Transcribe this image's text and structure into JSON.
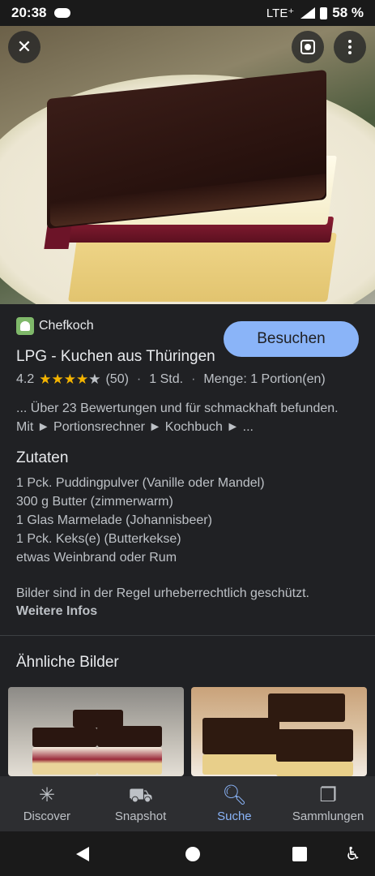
{
  "status_bar": {
    "time": "20:38",
    "network": "LTE⁺",
    "battery": "58 %"
  },
  "hero": {
    "close_icon": "close-icon",
    "lens_icon": "lens-icon",
    "more_icon": "more-vert-icon"
  },
  "result": {
    "source": "Chefkoch",
    "visit_label": "Besuchen",
    "title": "LPG - Kuchen aus Thüringen",
    "rating": "4.2",
    "stars_filled": 4,
    "reviews": "(50)",
    "duration": "1 Std.",
    "quantity": "Menge: 1 Portion(en)",
    "snippet": "... Über 23 Bewertungen und für schmackhaft befunden. Mit ► Portionsrechner ► Kochbuch ► ..."
  },
  "ingredients": {
    "title": "Zutaten",
    "items": [
      "1 Pck. Puddingpulver (Vanille oder Mandel)",
      "300 g Butter (zimmerwarm)",
      "1 Glas Marmelade (Johannisbeer)",
      "1 Pck. Keks(e) (Butterkekse)",
      "etwas Weinbrand oder Rum"
    ]
  },
  "copyright": {
    "text": "Bilder sind in der Regel urheberrechtlich geschützt.",
    "link": "Weitere Infos"
  },
  "similar": {
    "title": "Ähnliche Bilder"
  },
  "bottom_nav": {
    "items": [
      {
        "label": "Discover",
        "icon": "asterisk-icon"
      },
      {
        "label": "Snapshot",
        "icon": "snapshot-icon"
      },
      {
        "label": "Suche",
        "icon": "search-icon",
        "active": true
      },
      {
        "label": "Sammlungen",
        "icon": "collections-icon"
      }
    ]
  },
  "colors": {
    "accent": "#8ab4f8",
    "background": "#202124",
    "star": "#f4b400"
  }
}
